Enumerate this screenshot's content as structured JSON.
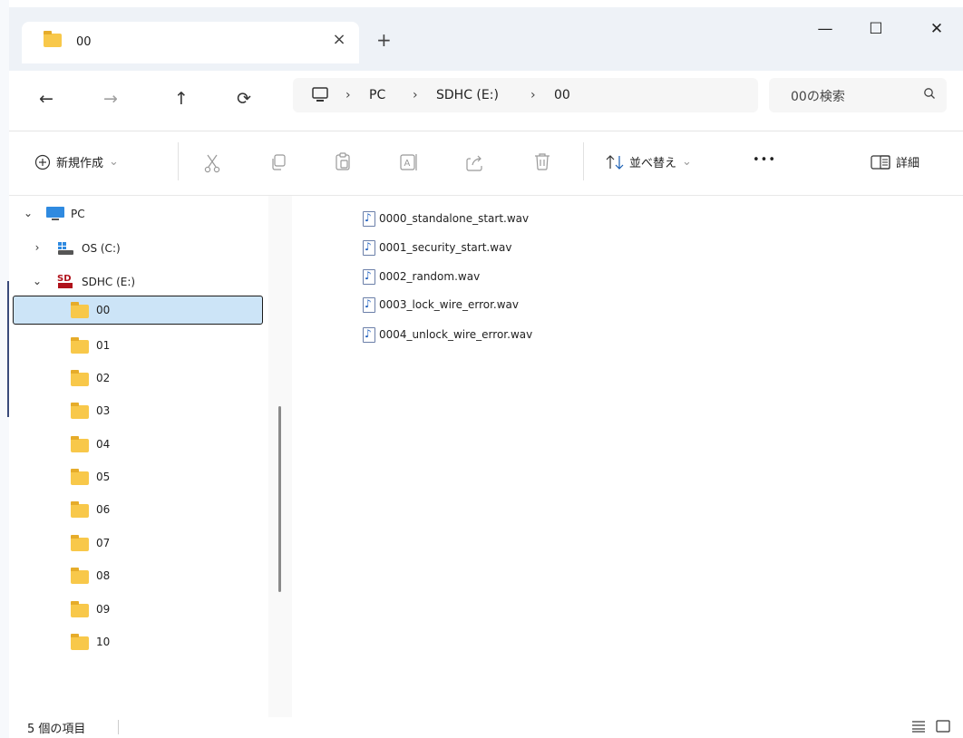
{
  "tab": {
    "title": "00",
    "close": "×",
    "new": "+"
  },
  "window": {
    "minimize": "—",
    "maximize": "☐",
    "close": "✕"
  },
  "nav": {
    "back": "←",
    "forward": "→",
    "up": "↑",
    "refresh": "⟳"
  },
  "breadcrumb": {
    "sep": "›",
    "items": [
      "PC",
      "SDHC (E:)",
      "00"
    ]
  },
  "search": {
    "placeholder": "00の検索"
  },
  "commands": {
    "new_label": "新規作成",
    "sort_label": "並べ替え",
    "more": "•••",
    "details_label": "詳細"
  },
  "sidebar": {
    "pc": "PC",
    "os": "OS (C:)",
    "sdhc": "SDHC (E:)",
    "folders": [
      "00",
      "01",
      "02",
      "03",
      "04",
      "05",
      "06",
      "07",
      "08",
      "09",
      "10"
    ]
  },
  "files": [
    "0000_standalone_start.wav",
    "0001_security_start.wav",
    "0002_random.wav",
    "0003_lock_wire_error.wav",
    "0004_unlock_wire_error.wav"
  ],
  "status": {
    "count": "5 個の項目"
  }
}
